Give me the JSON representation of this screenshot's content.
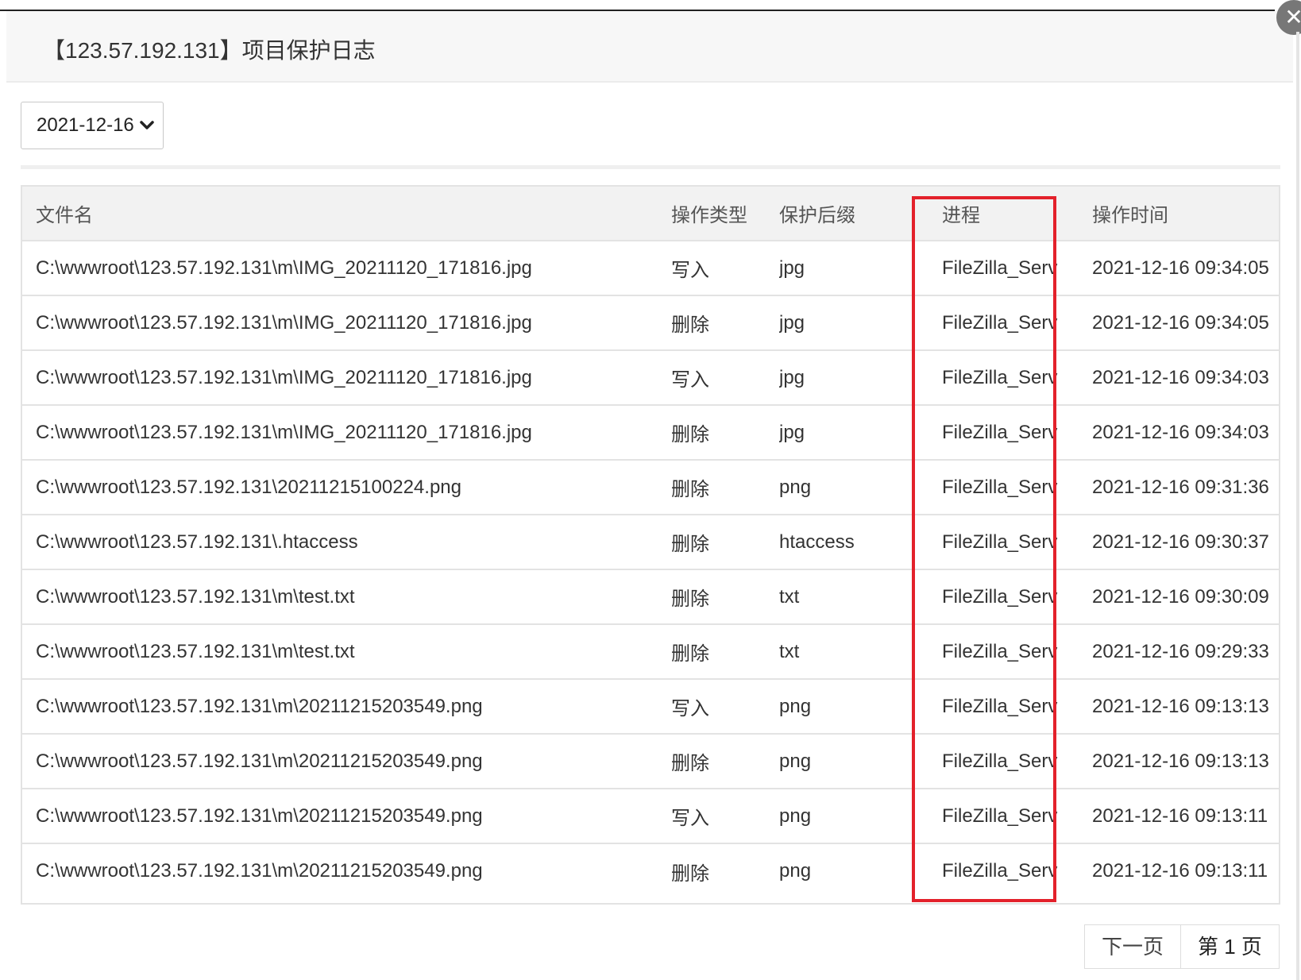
{
  "dialog": {
    "title": "【123.57.192.131】项目保护日志",
    "close_glyph": "✕"
  },
  "filter": {
    "selected_date": "2021-12-16",
    "chevron_glyph": "❯"
  },
  "table": {
    "headers": [
      "文件名",
      "操作类型",
      "保护后缀",
      "进程",
      "操作时间"
    ],
    "rows": [
      [
        "C:\\wwwroot\\123.57.192.131\\m\\IMG_20211120_171816.jpg",
        "写入",
        "jpg",
        "FileZilla_Serv",
        "2021-12-16 09:34:05"
      ],
      [
        "C:\\wwwroot\\123.57.192.131\\m\\IMG_20211120_171816.jpg",
        "删除",
        "jpg",
        "FileZilla_Serv",
        "2021-12-16 09:34:05"
      ],
      [
        "C:\\wwwroot\\123.57.192.131\\m\\IMG_20211120_171816.jpg",
        "写入",
        "jpg",
        "FileZilla_Serv",
        "2021-12-16 09:34:03"
      ],
      [
        "C:\\wwwroot\\123.57.192.131\\m\\IMG_20211120_171816.jpg",
        "删除",
        "jpg",
        "FileZilla_Serv",
        "2021-12-16 09:34:03"
      ],
      [
        "C:\\wwwroot\\123.57.192.131\\20211215100224.png",
        "删除",
        "png",
        "FileZilla_Serv",
        "2021-12-16 09:31:36"
      ],
      [
        "C:\\wwwroot\\123.57.192.131\\.htaccess",
        "删除",
        "htaccess",
        "FileZilla_Serv",
        "2021-12-16 09:30:37"
      ],
      [
        "C:\\wwwroot\\123.57.192.131\\m\\test.txt",
        "删除",
        "txt",
        "FileZilla_Serv",
        "2021-12-16 09:30:09"
      ],
      [
        "C:\\wwwroot\\123.57.192.131\\m\\test.txt",
        "删除",
        "txt",
        "FileZilla_Serv",
        "2021-12-16 09:29:33"
      ],
      [
        "C:\\wwwroot\\123.57.192.131\\m\\20211215203549.png",
        "写入",
        "png",
        "FileZilla_Serv",
        "2021-12-16 09:13:13"
      ],
      [
        "C:\\wwwroot\\123.57.192.131\\m\\20211215203549.png",
        "删除",
        "png",
        "FileZilla_Serv",
        "2021-12-16 09:13:13"
      ],
      [
        "C:\\wwwroot\\123.57.192.131\\m\\20211215203549.png",
        "写入",
        "png",
        "FileZilla_Serv",
        "2021-12-16 09:13:11"
      ],
      [
        "C:\\wwwroot\\123.57.192.131\\m\\20211215203549.png",
        "删除",
        "png",
        "FileZilla_Serv",
        "2021-12-16 09:13:11"
      ]
    ]
  },
  "pagination": {
    "next_label": "下一页",
    "current_label": "第 1 页"
  },
  "colors": {
    "highlight": "#e3212b",
    "header_bg": "#f2f2f2"
  }
}
